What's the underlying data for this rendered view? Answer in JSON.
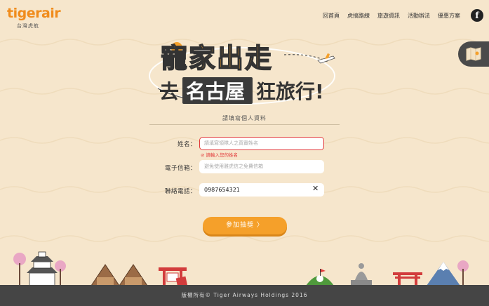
{
  "header": {
    "logo_text": "tigerair",
    "logo_sub": "台灣虎航",
    "nav": [
      "回首頁",
      "虎搞路線",
      "旅遊資訊",
      "活動辦法",
      "優惠方案"
    ],
    "facebook_glyph": "f"
  },
  "hero": {
    "line1": "寵家出走",
    "line2_pre": "去",
    "line2_city": "名古屋",
    "line2_post": "狂旅行!"
  },
  "form": {
    "subtitle": "請填寫個人資料",
    "name_label": "姓名：",
    "name_placeholder": "請填寫領隊人之真實姓名",
    "name_error": "⊘ 請輸入您的姓名",
    "email_label": "電子信箱：",
    "email_placeholder": "避免使用雅虎信之免費信箱",
    "phone_label": "聯絡電話：",
    "phone_value": "0987654321",
    "clear_glyph": "✕",
    "submit_label": "參加抽獎  〉"
  },
  "footer": {
    "copyright": "版權所有© Tiger Airways Holdings 2016"
  },
  "colors": {
    "background": "#f6e6cc",
    "accent_orange": "#f5a02a",
    "error_red": "#e23b3b",
    "footer_dark": "#454545"
  }
}
